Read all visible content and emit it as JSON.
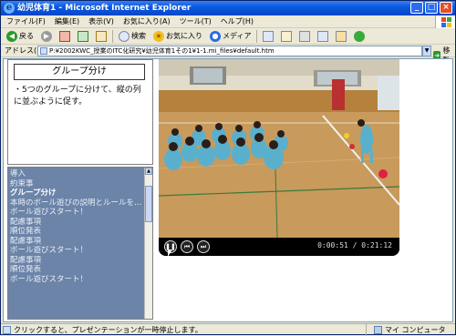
{
  "window": {
    "title": "幼児体育1 - Microsoft Internet Explorer",
    "controls": {
      "minimize": "_",
      "maximize": "□",
      "close": "×"
    }
  },
  "menu": [
    "ファイル(F)",
    "編集(E)",
    "表示(V)",
    "お気に入り(A)",
    "ツール(T)",
    "ヘルプ(H)"
  ],
  "toolbar": {
    "back_label": "戻る",
    "search_label": "検索",
    "favorites_label": "お気に入り",
    "media_label": "メディア"
  },
  "address": {
    "label": "アドレス(D)",
    "value": "P:¥2002KWC_授業のITC化研究¥幼児体育1その1¥1-1.mi_files¥default.htm",
    "go_label": "移動"
  },
  "slide": {
    "title": "グループ分け",
    "description": "・5つのグループに分けて、縦の列に並ぶように促す。"
  },
  "outline": {
    "items": [
      "導入",
      "約束事",
      "グループ分け",
      "本時のボール遊びの説明とルールを…",
      "ボール遊びスタート！",
      "配慮事項",
      "順位発表",
      "配慮事項",
      "ボール遊びスタート！",
      "配慮事項",
      "順位発表",
      "ボール遊びスタート！"
    ],
    "current_index": 2
  },
  "player": {
    "time": "0:00:51 / 0:21:12",
    "pause_icon": "pause-icon",
    "prev_icon": "previous-icon",
    "next_icon": "next-icon"
  },
  "status": {
    "message": "クリックすると、プレゼンテーションが一時停止します。",
    "zone": "マイ コンピュータ"
  }
}
